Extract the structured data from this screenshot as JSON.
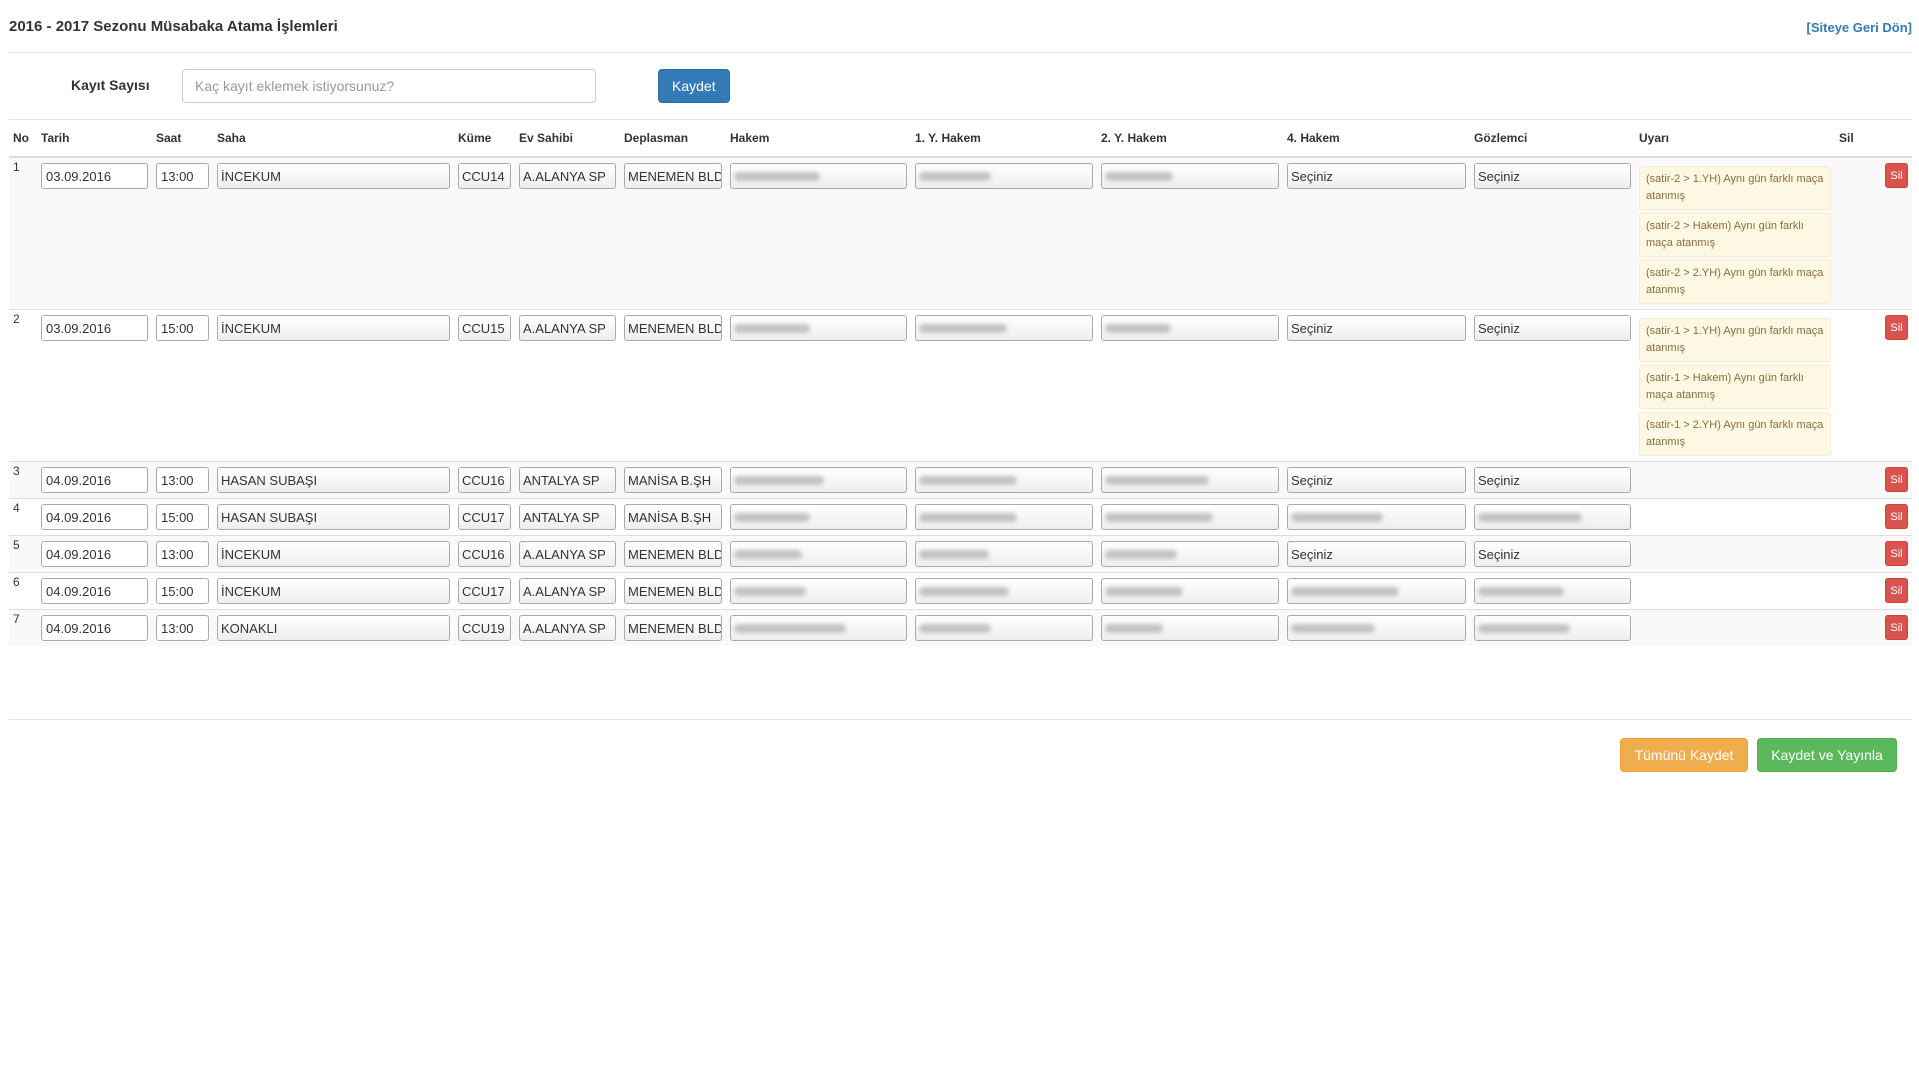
{
  "header": {
    "title": "2016 - 2017 Sezonu Müsabaka Atama İşlemleri",
    "back_link": "[Siteye Geri Dön]"
  },
  "record_count": {
    "label": "Kayıt Sayısı",
    "placeholder": "Kaç kayıt eklemek istiyorsunuz?",
    "value": "",
    "save_label": "Kaydet"
  },
  "table": {
    "columns": [
      "No",
      "Tarih",
      "Saat",
      "Saha",
      "Küme",
      "Ev Sahibi",
      "Deplasman",
      "Hakem",
      "1. Y. Hakem",
      "2. Y. Hakem",
      "4. Hakem",
      "Gözlemci",
      "Uyarı",
      "Sil"
    ],
    "delete_label": "Sil",
    "rows": [
      {
        "no": "1",
        "date": "03.09.2016",
        "time": "13:00",
        "field": "İNCEKUM",
        "group": "CCU14",
        "home": "A.ALANYA SP",
        "away": "MENEMEN BLD",
        "referee": "",
        "assistant1": "",
        "assistant2": "",
        "fourth": "Seçiniz",
        "observer": "Seçiniz",
        "warnings": [
          "(satir-2 > 1.YH) Aynı gün farklı maça atanmış",
          "(satir-2 > Hakem) Aynı gün farklı maça atanmış",
          "(satir-2 > 2.YH) Aynı gün farklı maça atanmış"
        ]
      },
      {
        "no": "2",
        "date": "03.09.2016",
        "time": "15:00",
        "field": "İNCEKUM",
        "group": "CCU15",
        "home": "A.ALANYA SP",
        "away": "MENEMEN BLD",
        "referee": "",
        "assistant1": "",
        "assistant2": "",
        "fourth": "Seçiniz",
        "observer": "Seçiniz",
        "warnings": [
          "(satir-1 > 1.YH) Aynı gün farklı maça atanmış",
          "(satir-1 > Hakem) Aynı gün farklı maça atanmış",
          "(satir-1 > 2.YH) Aynı gün farklı maça atanmış"
        ]
      },
      {
        "no": "3",
        "date": "04.09.2016",
        "time": "13:00",
        "field": "HASAN SUBAŞI",
        "group": "CCU16",
        "home": "ANTALYA SP",
        "away": "MANİSA B.ŞH",
        "referee": "",
        "assistant1": "",
        "assistant2": "",
        "fourth": "Seçiniz",
        "observer": "Seçiniz",
        "warnings": []
      },
      {
        "no": "4",
        "date": "04.09.2016",
        "time": "15:00",
        "field": "HASAN SUBAŞI",
        "group": "CCU17",
        "home": "ANTALYA SP",
        "away": "MANİSA B.ŞH",
        "referee": "",
        "assistant1": "",
        "assistant2": "",
        "fourth": "",
        "observer": "",
        "warnings": []
      },
      {
        "no": "5",
        "date": "04.09.2016",
        "time": "13:00",
        "field": "İNCEKUM",
        "group": "CCU16",
        "home": "A.ALANYA SP",
        "away": "MENEMEN BLD",
        "referee": "",
        "assistant1": "",
        "assistant2": "",
        "fourth": "Seçiniz",
        "observer": "Seçiniz",
        "warnings": []
      },
      {
        "no": "6",
        "date": "04.09.2016",
        "time": "15:00",
        "field": "İNCEKUM",
        "group": "CCU17",
        "home": "A.ALANYA SP",
        "away": "MENEMEN BLD",
        "referee": "",
        "assistant1": "",
        "assistant2": "",
        "fourth": "",
        "observer": "",
        "warnings": []
      },
      {
        "no": "7",
        "date": "04.09.2016",
        "time": "13:00",
        "field": "KONAKLI",
        "group": "CCU19",
        "home": "A.ALANYA SP",
        "away": "MENEMEN BLD",
        "referee": "",
        "assistant1": "",
        "assistant2": "",
        "fourth": "",
        "observer": "",
        "warnings": []
      }
    ]
  },
  "footer": {
    "save_all_label": "Tümünü Kaydet",
    "save_publish_label": "Kaydet ve Yayınla"
  },
  "colors": {
    "primary": "#337ab7",
    "danger": "#d9534f",
    "warning": "#f0ad4e",
    "success": "#5cb85c",
    "alert_bg": "#fcf8e3",
    "alert_text": "#8a6d3b"
  }
}
